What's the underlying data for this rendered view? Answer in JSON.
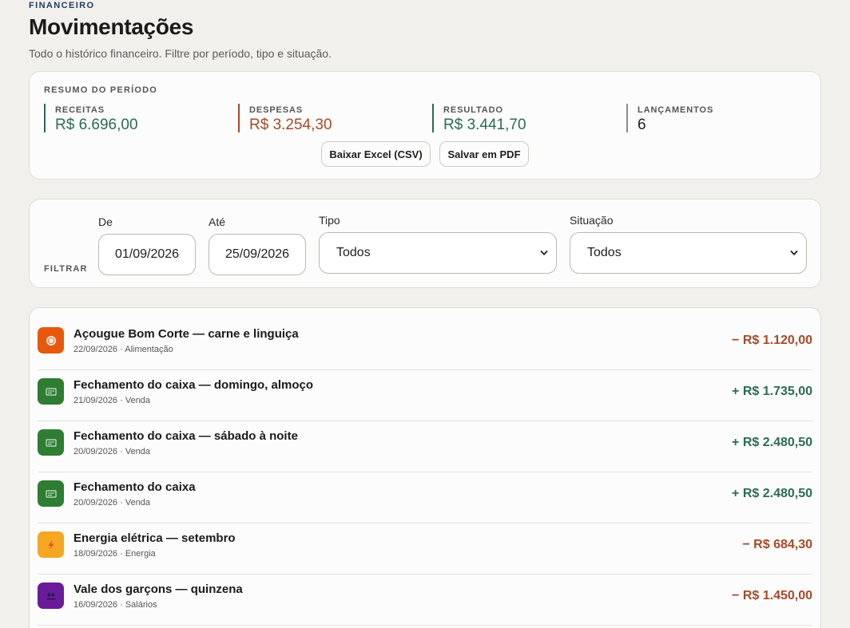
{
  "header": {
    "eyebrow": "FINANCEIRO",
    "title": "Movimentações",
    "subtitle": "Todo o histórico financeiro. Filtre por período, tipo e situação."
  },
  "summary": {
    "label": "RESUMO DO PERÍODO",
    "stats": [
      {
        "label": "RECEITAS",
        "value": "R$ 6.696,00",
        "color": "#2b6b56"
      },
      {
        "label": "DESPESAS",
        "value": "R$ 3.254,30",
        "color": "#a64a2a"
      },
      {
        "label": "RESULTADO",
        "value": "R$ 3.441,70",
        "color": "#2b6b56"
      },
      {
        "label": "LANÇAMENTOS",
        "value": "6",
        "color": "#1d1d1d"
      }
    ],
    "export_csv_label": "Baixar Excel (CSV)",
    "export_pdf_label": "Salvar em PDF"
  },
  "filters": {
    "tag": "FILTRAR",
    "from_label": "De",
    "from_value": "01/09/2026",
    "to_label": "Até",
    "to_value": "25/09/2026",
    "type_label": "Tipo",
    "type_value": "Todos",
    "status_label": "Situação",
    "status_value": "Todos"
  },
  "transactions": [
    {
      "title": "Açougue Bom Corte — carne e linguiça",
      "date": "22/09/2026",
      "category": "Alimentação",
      "amount": "− R$ 1.120,00",
      "direction": "out",
      "icon": "plate-icon",
      "icon_color": "#e8580c"
    },
    {
      "title": "Fechamento do caixa — domingo, almoço",
      "date": "21/09/2026",
      "category": "Venda",
      "amount": "+ R$ 1.735,00",
      "direction": "in",
      "icon": "cash-register-icon",
      "icon_color": "#2e7d32"
    },
    {
      "title": "Fechamento do caixa — sábado à noite",
      "date": "20/09/2026",
      "category": "Venda",
      "amount": "+ R$ 2.480,50",
      "direction": "in",
      "icon": "cash-register-icon",
      "icon_color": "#2e7d32"
    },
    {
      "title": "Fechamento do caixa",
      "date": "20/09/2026",
      "category": "Venda",
      "amount": "+ R$ 2.480,50",
      "direction": "in",
      "icon": "cash-register-icon",
      "icon_color": "#2e7d32"
    },
    {
      "title": "Energia elétrica — setembro",
      "date": "18/09/2026",
      "category": "Energia",
      "amount": "− R$ 684,30",
      "direction": "out",
      "icon": "lightning-icon",
      "icon_color": "#f5a623"
    },
    {
      "title": "Vale dos garçons — quinzena",
      "date": "16/09/2026",
      "category": "Salários",
      "amount": "− R$ 1.450,00",
      "direction": "out",
      "icon": "people-icon",
      "icon_color": "#6a1b9a"
    }
  ]
}
